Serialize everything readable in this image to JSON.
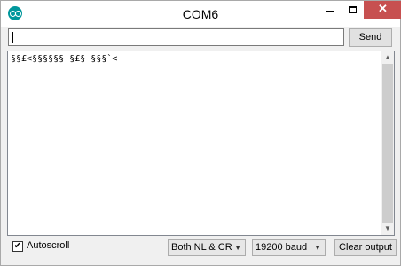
{
  "window": {
    "title": "COM6",
    "controls": {
      "minimize": "",
      "maximize": "",
      "close": "✕"
    }
  },
  "input": {
    "value": ""
  },
  "send_button": {
    "label": "Send"
  },
  "output": {
    "text": "§§£<§§§§§§ §£§ §§§`<"
  },
  "footer": {
    "autoscroll": {
      "label": "Autoscroll",
      "checked": true
    },
    "line_ending": {
      "selected": "Both NL & CR"
    },
    "baud_rate": {
      "selected": "19200 baud"
    },
    "clear_button": {
      "label": "Clear output"
    }
  },
  "icons": {
    "app": "arduino-logo-icon",
    "checkbox": "checkmark-icon",
    "dropdown": "chevron-down-icon",
    "scroll_up": "arrow-up-icon",
    "scroll_down": "arrow-down-icon"
  },
  "colors": {
    "close_button": "#c75050",
    "app_icon": "#00979c"
  }
}
